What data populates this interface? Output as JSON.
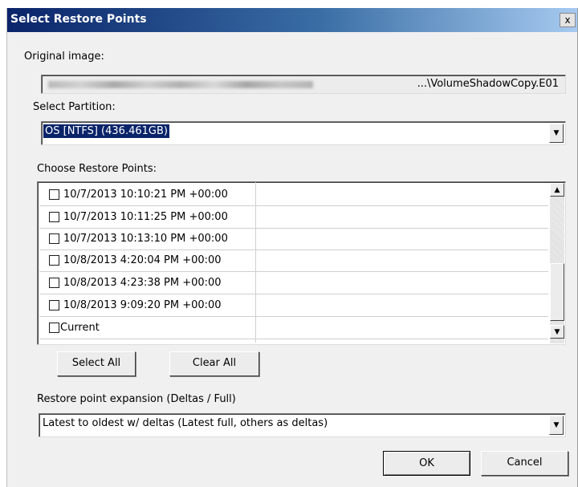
{
  "window": {
    "title": "Select Restore Points",
    "close_label": "x"
  },
  "original_image": {
    "label": "Original image:",
    "path_visible": "...\\VolumeShadowCopy.E01"
  },
  "partition": {
    "label": "Select Partition:",
    "value": "OS [NTFS] (436.461GB)"
  },
  "restore_points": {
    "label": "Choose Restore Points:",
    "items": [
      {
        "label": "10/7/2013 10:10:21 PM +00:00",
        "checked": false
      },
      {
        "label": "10/7/2013 10:11:25 PM +00:00",
        "checked": false
      },
      {
        "label": "10/7/2013 10:13:10 PM +00:00",
        "checked": false
      },
      {
        "label": "10/8/2013 4:20:04 PM +00:00",
        "checked": false
      },
      {
        "label": "10/8/2013 4:23:38 PM +00:00",
        "checked": false
      },
      {
        "label": "10/8/2013 9:09:20 PM +00:00",
        "checked": false
      },
      {
        "label": "Current",
        "checked": false
      }
    ]
  },
  "buttons": {
    "select_all": "Select All",
    "clear_all": "Clear All",
    "ok": "OK",
    "cancel": "Cancel"
  },
  "expansion": {
    "label": "Restore point expansion (Deltas / Full)",
    "value": "Latest to oldest w/ deltas (Latest full, others as deltas)"
  },
  "icons": {
    "dropdown_arrow": "▼",
    "scroll_up": "▲",
    "scroll_down": "▼"
  }
}
